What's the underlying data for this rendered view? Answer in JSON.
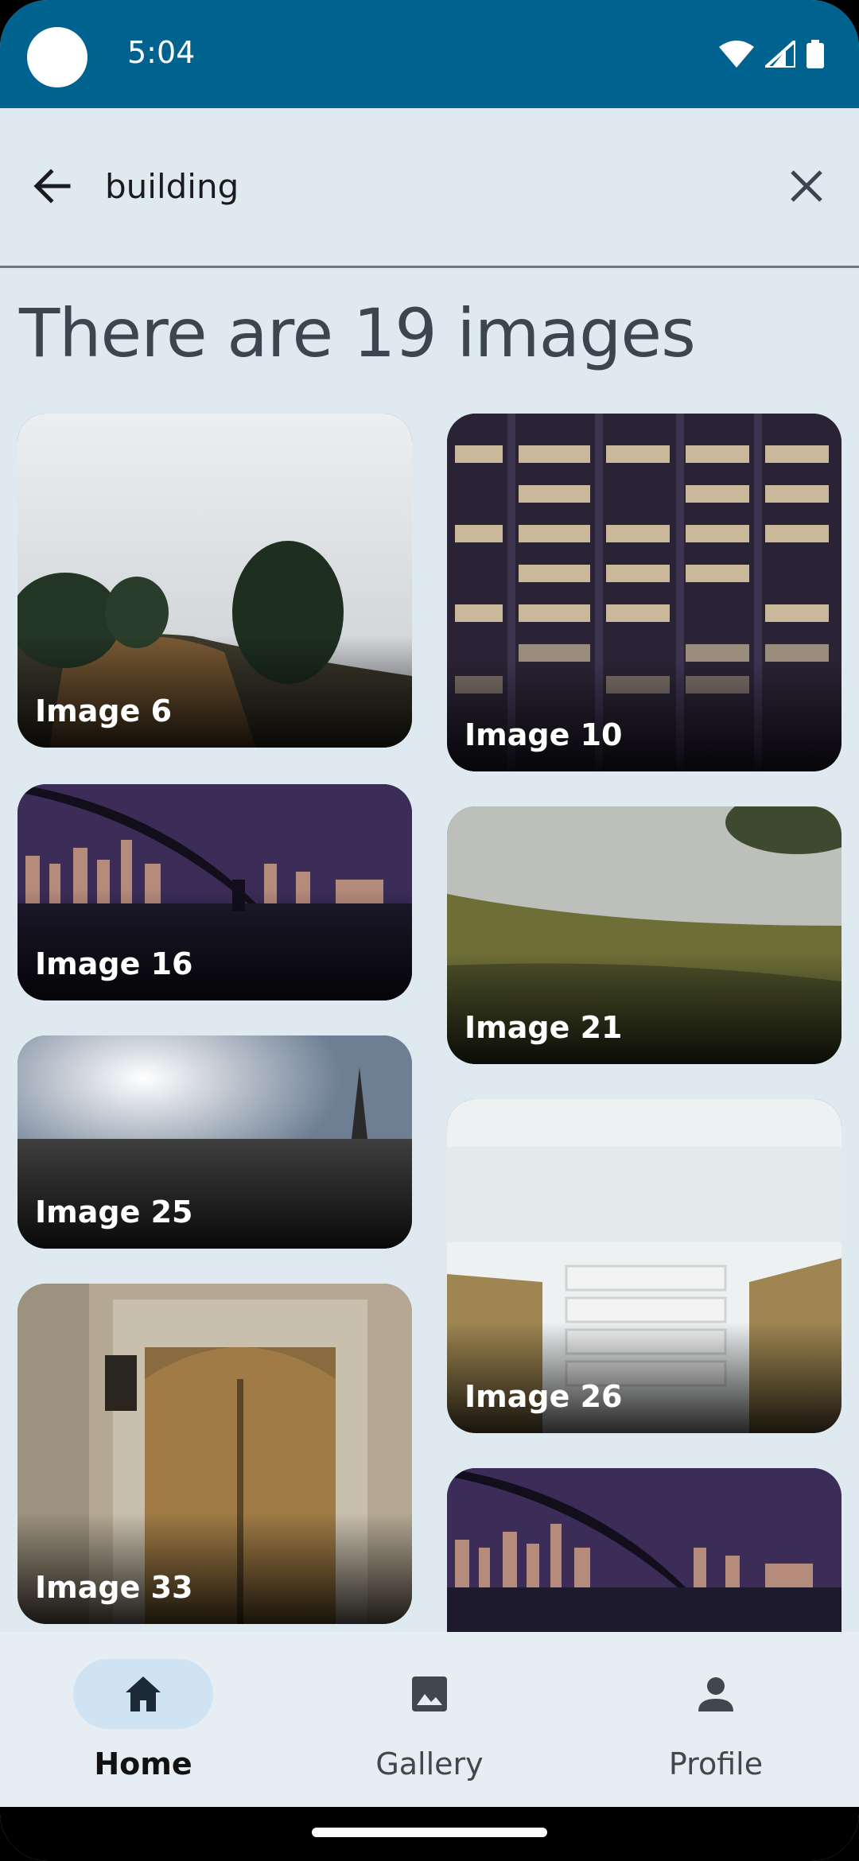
{
  "status_bar": {
    "time": "5:04"
  },
  "search": {
    "query": "building",
    "placeholder": ""
  },
  "results": {
    "heading": "There are 19 images"
  },
  "images": [
    {
      "label": "Image 6"
    },
    {
      "label": "Image 10"
    },
    {
      "label": "Image 16"
    },
    {
      "label": "Image 21"
    },
    {
      "label": "Image 25"
    },
    {
      "label": "Image 26"
    },
    {
      "label": "Image 33"
    },
    {
      "label": ""
    }
  ],
  "bottom_nav": {
    "items": [
      {
        "label": "Home",
        "icon": "home-icon",
        "active": true
      },
      {
        "label": "Gallery",
        "icon": "image-icon",
        "active": false
      },
      {
        "label": "Profile",
        "icon": "person-icon",
        "active": false
      }
    ]
  },
  "colors": {
    "status_bar": "#00628f",
    "background": "#dfe9f0",
    "nav_active": "#cfe3f3"
  }
}
